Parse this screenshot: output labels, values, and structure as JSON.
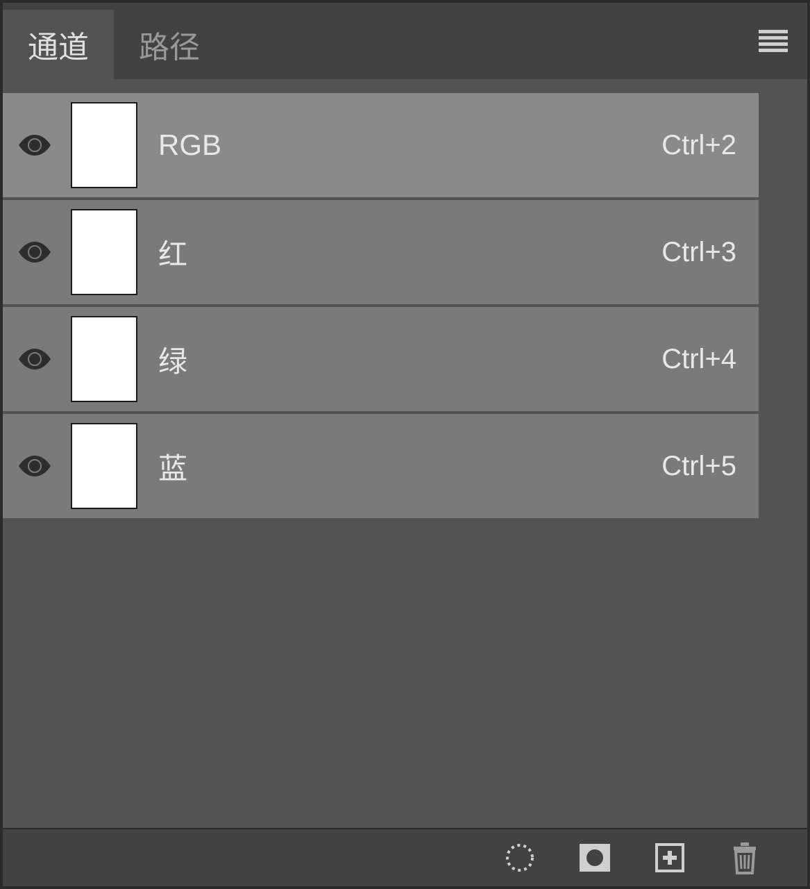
{
  "tabs": [
    {
      "label": "通道",
      "active": true
    },
    {
      "label": "路径",
      "active": false
    }
  ],
  "channels": [
    {
      "name": "RGB",
      "shortcut": "Ctrl+2",
      "visible": true
    },
    {
      "name": "红",
      "shortcut": "Ctrl+3",
      "visible": true
    },
    {
      "name": "绿",
      "shortcut": "Ctrl+4",
      "visible": true
    },
    {
      "name": "蓝",
      "shortcut": "Ctrl+5",
      "visible": true
    }
  ],
  "footer_icons": [
    {
      "name": "load-selection-icon"
    },
    {
      "name": "save-mask-icon"
    },
    {
      "name": "new-channel-icon"
    },
    {
      "name": "delete-channel-icon"
    }
  ]
}
